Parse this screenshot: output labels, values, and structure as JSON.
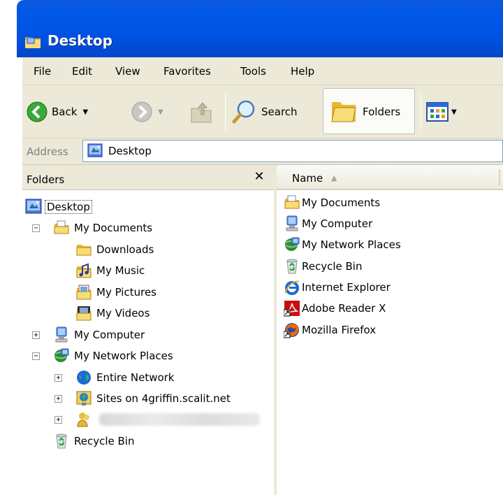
{
  "window": {
    "title": "Desktop"
  },
  "menu": [
    "File",
    "Edit",
    "View",
    "Favorites",
    "Tools",
    "Help"
  ],
  "toolbar": {
    "back_label": "Back",
    "search_label": "Search",
    "folders_label": "Folders"
  },
  "address": {
    "label": "Address",
    "value": "Desktop"
  },
  "folders_pane": {
    "title": "Folders",
    "close_glyph": "✕",
    "tree": {
      "desktop": "Desktop",
      "my_documents": "My Documents",
      "downloads": "Downloads",
      "my_music": "My Music",
      "my_pictures": "My Pictures",
      "my_videos": "My Videos",
      "my_computer": "My Computer",
      "my_network_places": "My Network Places",
      "entire_network": "Entire Network",
      "sites_on": "Sites on 4griffin.scalit.net",
      "recycle_bin": "Recycle Bin"
    }
  },
  "list_pane": {
    "column_name": "Name",
    "sort_glyph": "▲",
    "items": [
      "My Documents",
      "My Computer",
      "My Network Places",
      "Recycle Bin",
      "Internet Explorer",
      "Adobe Reader X",
      "Mozilla Firefox"
    ]
  },
  "colors": {
    "titlebar": "#0057e8",
    "chrome": "#ece9d8",
    "accent": "#316ac5"
  }
}
